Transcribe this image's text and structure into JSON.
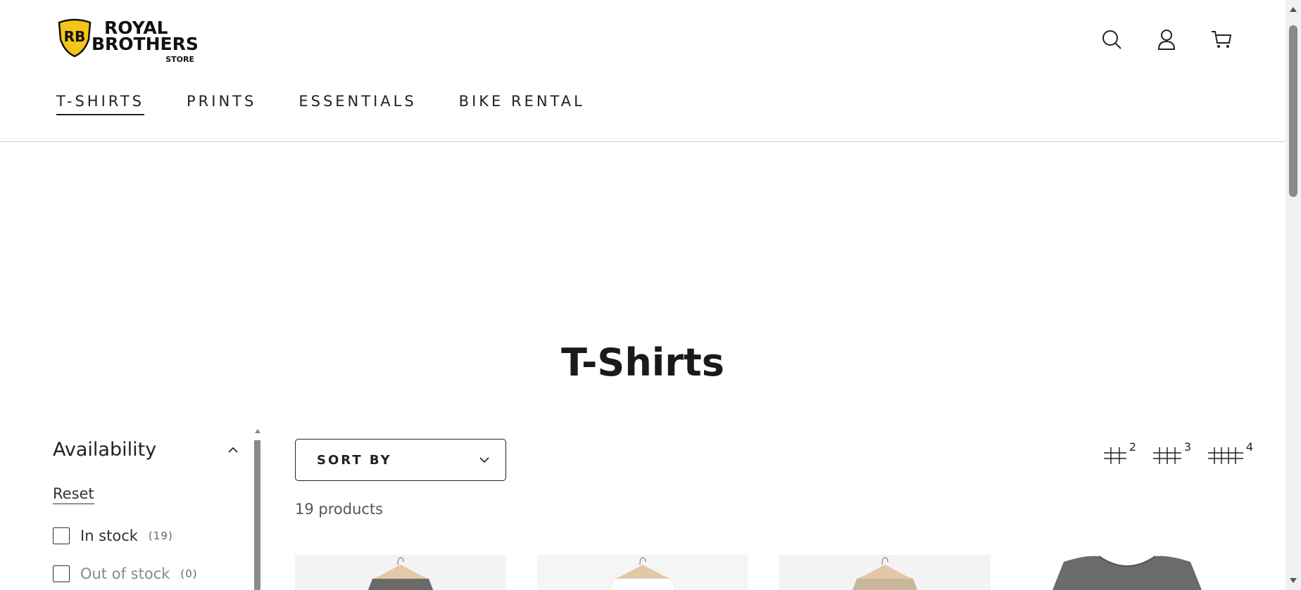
{
  "brand": {
    "name_line1": "ROYAL",
    "name_line2": "BROTHERS",
    "sub": "STORE",
    "badge_text": "RB",
    "badge_color": "#f5c518",
    "logo_icon": "royal-brothers-shield-icon"
  },
  "header_icons": [
    "search-icon",
    "account-icon",
    "cart-icon"
  ],
  "nav": {
    "items": [
      {
        "label": "T-SHIRTS",
        "active": true
      },
      {
        "label": "PRINTS",
        "active": false
      },
      {
        "label": "ESSENTIALS",
        "active": false
      },
      {
        "label": "BIKE RENTAL",
        "active": false
      }
    ]
  },
  "collection": {
    "title": "T-Shirts",
    "product_count": "19 products"
  },
  "filters": {
    "title": "Availability",
    "reset": "Reset",
    "options": [
      {
        "label": "In stock",
        "count": "(19)",
        "disabled": false
      },
      {
        "label": "Out of stock",
        "count": "(0)",
        "disabled": true
      }
    ]
  },
  "sort": {
    "label": "SORT BY"
  },
  "grid_options": [
    "2",
    "3",
    "4"
  ],
  "colors": {
    "text": "#1f1f1f",
    "muted": "#8a8a8a",
    "border": "#cfcfcf",
    "accent": "#f5c518"
  }
}
